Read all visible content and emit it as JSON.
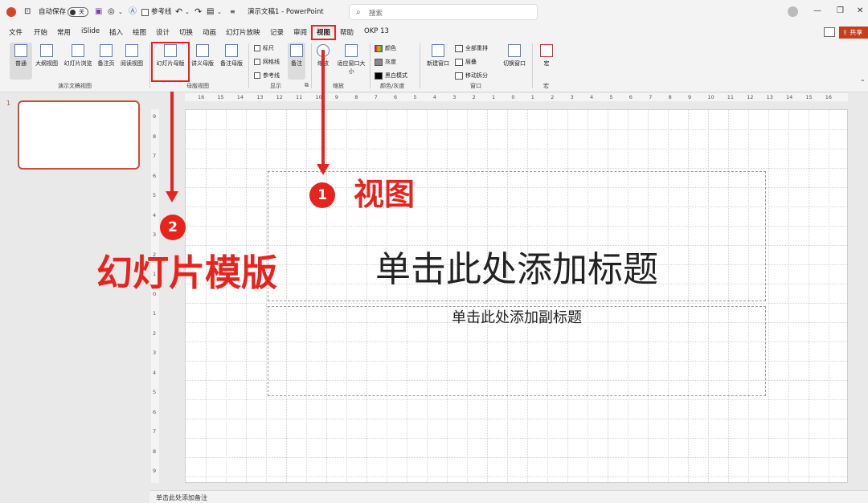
{
  "titlebar": {
    "autosave_label": "自动保存",
    "autosave_state": "关",
    "ref_lines_label": "参考线",
    "doc_title": "演示文稿1 - PowerPoint",
    "search_placeholder": "搜索"
  },
  "tabs": [
    {
      "label": "文件"
    },
    {
      "label": "开始"
    },
    {
      "label": "常用"
    },
    {
      "label": "iSlide"
    },
    {
      "label": "插入"
    },
    {
      "label": "绘图"
    },
    {
      "label": "设计"
    },
    {
      "label": "切换"
    },
    {
      "label": "动画"
    },
    {
      "label": "幻灯片放映"
    },
    {
      "label": "记录"
    },
    {
      "label": "审阅"
    },
    {
      "label": "视图"
    },
    {
      "label": "帮助"
    },
    {
      "label": "OKP 13"
    }
  ],
  "active_tab": "视图",
  "share_label": "共享",
  "ribbon": {
    "pres_views": [
      "普通",
      "大纲视图",
      "幻灯片浏览",
      "备注页",
      "阅读视图"
    ],
    "pres_views_group": "演示文稿视图",
    "master_views": [
      "幻灯片母版",
      "讲义母版",
      "备注母版"
    ],
    "master_views_group": "母版视图",
    "show_items": [
      "标尺",
      "网格线",
      "参考线"
    ],
    "notes_label": "备注",
    "show_group": "显示",
    "zoom_label": "缩放",
    "fit_label": "适应窗口大小",
    "zoom_group": "缩放",
    "color_items": [
      "颜色",
      "灰度",
      "黑白模式"
    ],
    "color_group": "颜色/灰度",
    "new_window": "新建窗口",
    "arrange_items": [
      "全部重排",
      "层叠",
      "移动拆分"
    ],
    "switch_window": "切换窗口",
    "window_group": "窗口",
    "macro_label": "宏",
    "macro_group": "宏"
  },
  "thumbnails": [
    {
      "number": "1"
    }
  ],
  "ruler": {
    "h_ticks": [
      "16",
      "15",
      "14",
      "13",
      "12",
      "11",
      "10",
      "9",
      "8",
      "7",
      "6",
      "5",
      "4",
      "3",
      "2",
      "1",
      "0",
      "1",
      "2",
      "3",
      "4",
      "5",
      "6",
      "7",
      "8",
      "9",
      "10",
      "11",
      "12",
      "13",
      "14",
      "15",
      "16"
    ],
    "v_ticks": [
      "9",
      "8",
      "7",
      "6",
      "5",
      "4",
      "3",
      "2",
      "1",
      "0",
      "1",
      "2",
      "3",
      "4",
      "5",
      "6",
      "7",
      "8",
      "9"
    ]
  },
  "slide": {
    "title_placeholder": "单击此处添加标题",
    "subtitle_placeholder": "单击此处添加副标题"
  },
  "notes_placeholder": "单击此处添加备注",
  "annotations": {
    "step1_number": "1",
    "step1_label": "视图",
    "step2_number": "2",
    "step2_label": "幻灯片模版",
    "accent_color": "#e8231e"
  }
}
